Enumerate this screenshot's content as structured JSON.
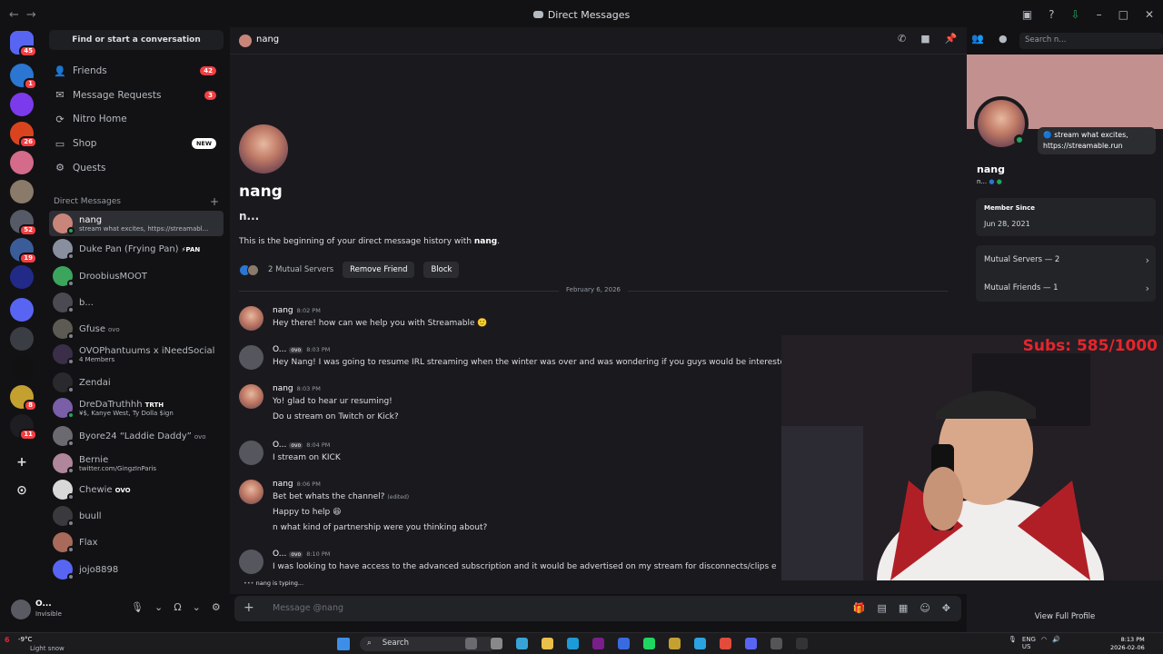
{
  "window": {
    "title": "Direct Messages"
  },
  "servers": [
    {
      "badge": "45",
      "color": "#5865f2"
    },
    {
      "badge": "1",
      "color": "#2a76d2"
    },
    {
      "badge": "",
      "color": "#7c3aed"
    },
    {
      "badge": "26",
      "color": "#d9441f"
    },
    {
      "badge": "",
      "color": "#d46b8a"
    },
    {
      "badge": "",
      "color": "#8a7a6a"
    },
    {
      "badge": "52",
      "color": "#555a66"
    },
    {
      "badge": "19",
      "color": "#3a5d99"
    },
    {
      "badge": "",
      "color": "#222a88"
    },
    {
      "badge": "",
      "color": "#5865f2"
    },
    {
      "badge": "",
      "color": "#3b3d44"
    },
    {
      "badge": "",
      "color": "#111111"
    },
    {
      "badge": "8",
      "color": "#c4a030"
    },
    {
      "badge": "11",
      "color": "#1e1e22"
    }
  ],
  "dm_sidebar": {
    "find": "Find or start a conversation",
    "nav": [
      {
        "label": "Friends",
        "badge": "42",
        "icon": "friends-icon"
      },
      {
        "label": "Message Requests",
        "badge": "3",
        "icon": "envelope-icon"
      },
      {
        "label": "Nitro Home",
        "badge": "",
        "icon": "nitro-icon"
      },
      {
        "label": "Shop",
        "badge": "NEW",
        "icon": "shop-icon"
      },
      {
        "label": "Quests",
        "badge": "",
        "icon": "quests-icon"
      }
    ],
    "header": "Direct Messages",
    "dms": [
      {
        "name": "nang",
        "sub": "stream what excites, https://streamabl...",
        "tag": "",
        "color": "#c9857a",
        "online": true,
        "selected": true
      },
      {
        "name": "Duke Pan (Frying Pan)",
        "sub": "",
        "tag": "⚡PAN",
        "color": "#8a8fa0",
        "online": false
      },
      {
        "name": "DroobiusMOOT",
        "sub": "",
        "tag": "",
        "color": "#3ba55d",
        "online": false
      },
      {
        "name": "b...",
        "sub": "",
        "tag": "",
        "color": "#4a4a52",
        "online": false
      },
      {
        "name": "Gfuse",
        "sub": "",
        "tag": "ovo",
        "color": "#5c5a52",
        "online": false
      },
      {
        "name": "OVOPhantuums x iNeedSocial",
        "sub": "4 Members",
        "tag": "",
        "color": "#3a2e48",
        "online": false
      },
      {
        "name": "Zendai",
        "sub": "",
        "tag": "",
        "color": "#2a2a2e",
        "online": false
      },
      {
        "name": "DreDaTruthhh",
        "sub": "¥$, Kanye West, Ty Dolla $ign",
        "tag": "TRTH",
        "color": "#7a5ea8",
        "online": true
      },
      {
        "name": "Byore24 “Laddie Daddy”",
        "sub": "",
        "tag": "ovo",
        "color": "#6a6a70",
        "online": false
      },
      {
        "name": "Bernie",
        "sub": "twitter.com/GingzInParis",
        "tag": "",
        "color": "#b0869a",
        "online": false
      },
      {
        "name": "Chewie",
        "sub": "",
        "tag": "OVO",
        "color": "#d8d8d8",
        "online": false
      },
      {
        "name": "buull",
        "sub": "",
        "tag": "",
        "color": "#3a3a3e",
        "online": false
      },
      {
        "name": "Flax",
        "sub": "",
        "tag": "",
        "color": "#a86a5a",
        "online": false
      },
      {
        "name": "jojo8898",
        "sub": "",
        "tag": "",
        "color": "#5865f2",
        "online": false
      }
    ]
  },
  "user_panel": {
    "name": "O...",
    "status": "Invisible"
  },
  "chat": {
    "recipient": "nang",
    "intro_display": "nang",
    "intro_username": "n...",
    "intro_text_prefix": "This is the beginning of your direct message history with ",
    "intro_text_name": "nang",
    "intro_text_suffix": ".",
    "mutual_servers": "2 Mutual Servers",
    "remove_friend": "Remove Friend",
    "block": "Block",
    "date_divider": "February 6, 2026",
    "messages": [
      {
        "author": "nang",
        "time": "8:02 PM",
        "tag": "",
        "lines": [
          "Hey there! how can we help you with Streamable 🙂"
        ]
      },
      {
        "author": "O...",
        "time": "8:03 PM",
        "tag": "ovo",
        "lines": [
          "Hey Nang! I was going to resume IRL streaming when the winter was over and was wondering if you guys would be intereste"
        ]
      },
      {
        "author": "nang",
        "time": "8:03 PM",
        "tag": "",
        "lines": [
          "Yo! glad to hear ur resuming!",
          "Do u stream on Twitch or Kick?"
        ]
      },
      {
        "author": "O...",
        "time": "8:04 PM",
        "tag": "ovo",
        "lines": [
          "I stream on KICK"
        ]
      },
      {
        "author": "nang",
        "time": "8:06 PM",
        "tag": "",
        "lines": [
          "Bet bet whats the channel?",
          "Happy to help 😆",
          "n what kind of partnership were you thinking about?"
        ],
        "edited": "(edited)"
      },
      {
        "author": "O...",
        "time": "8:10 PM",
        "tag": "ovo",
        "lines": [
          "I was looking to have access to the advanced subscription and it would be advertised on my stream for disconnects/clips e"
        ]
      }
    ],
    "typing": "nang is typing...",
    "composer_placeholder": "Message @nang"
  },
  "search": {
    "placeholder": "Search n..."
  },
  "profile": {
    "display": "nang",
    "username": "n...",
    "custom_status": "stream what excites, https://streamable.run",
    "member_since_label": "Member Since",
    "member_since": "Jun 28, 2021",
    "mutual_servers": "Mutual Servers — 2",
    "mutual_friends": "Mutual Friends — 1",
    "view_full": "View Full Profile"
  },
  "overlay": {
    "subs": "Subs: 585/1000"
  },
  "taskbar": {
    "weather_temp": "-9°C",
    "weather_desc": "Light snow",
    "weather_badge": "6",
    "search": "Search",
    "lang": "ENG",
    "region": "US",
    "time": "8:13 PM",
    "date": "2026-02-06"
  },
  "colors": {
    "accent": "#5865f2",
    "online": "#23a55a",
    "badge": "#f23f43",
    "subs_text": "#e7252c"
  }
}
